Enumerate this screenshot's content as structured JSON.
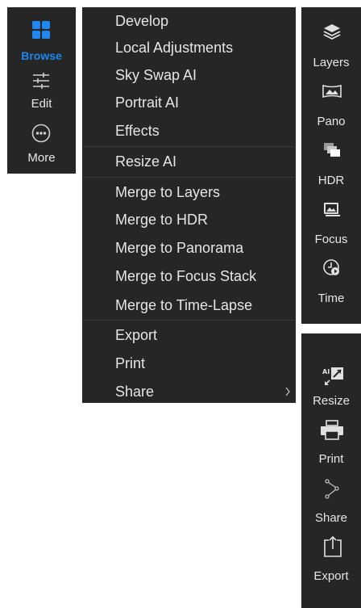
{
  "modes": {
    "browse": "Browse",
    "edit": "Edit",
    "more": "More",
    "active": "browse"
  },
  "menu": {
    "items": [
      "Develop",
      "Local Adjustments",
      "Sky Swap AI",
      "Portrait AI",
      "Effects",
      "Resize AI",
      "Merge to Layers",
      "Merge to HDR",
      "Merge to Panorama",
      "Merge to Focus Stack",
      "Merge to Time-Lapse",
      "Export",
      "Print",
      "Share"
    ]
  },
  "side_top": {
    "items": [
      "Layers",
      "Pano",
      "HDR",
      "Focus",
      "Time"
    ]
  },
  "side_bottom": {
    "items": [
      "Resize",
      "Print",
      "Share",
      "Export"
    ]
  },
  "colors": {
    "panel_bg": "#262626",
    "accent": "#1e87f0",
    "text": "#e6e6e6",
    "separator": "#3a3a3a"
  },
  "icons": {
    "browse": "grid-icon",
    "edit": "sliders-icon",
    "more": "more-dots-icon",
    "layers": "layers-icon",
    "pano": "panorama-icon",
    "hdr": "hdr-stack-icon",
    "focus": "focus-image-icon",
    "time": "time-lapse-icon",
    "resize": "ai-resize-icon",
    "print": "printer-icon",
    "share": "share-icon",
    "export": "export-icon"
  }
}
